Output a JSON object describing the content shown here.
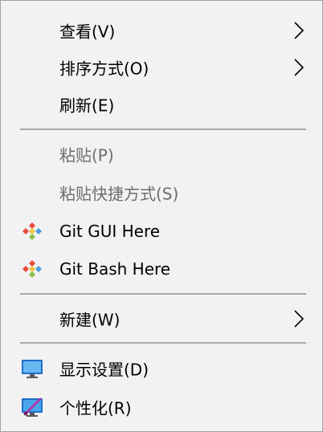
{
  "context_menu": {
    "items": [
      {
        "label": "查看(V)",
        "submenu": true
      },
      {
        "label": "排序方式(O)",
        "submenu": true
      },
      {
        "label": "刷新(E)"
      },
      {
        "label": "粘贴(P)",
        "disabled": true
      },
      {
        "label": "粘贴快捷方式(S)",
        "disabled": true
      },
      {
        "label": "Git GUI Here",
        "icon": "git-icon"
      },
      {
        "label": "Git Bash Here",
        "icon": "git-icon"
      },
      {
        "label": "新建(W)",
        "submenu": true
      },
      {
        "label": "显示设置(D)",
        "icon": "display-settings-icon"
      },
      {
        "label": "个性化(R)",
        "icon": "personalize-icon"
      }
    ]
  },
  "colors": {
    "menu_background": "#f2f2f2",
    "text": "#000000",
    "disabled_text": "#6d6d6d",
    "separator": "#a8a8a8",
    "border": "#a0a0a0"
  }
}
